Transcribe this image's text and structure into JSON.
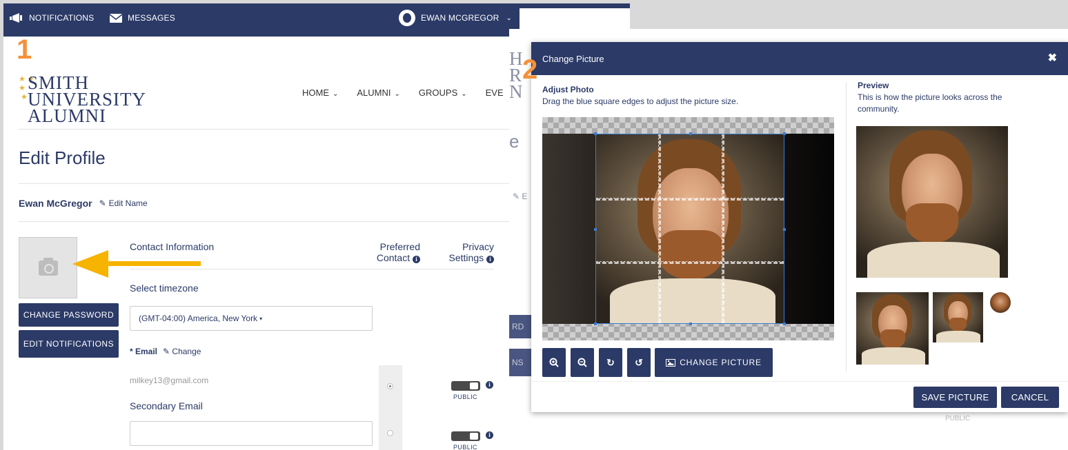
{
  "topbar": {
    "notifications_label": "NOTIFICATIONS",
    "messages_label": "MESSAGES",
    "user_label": "EWAN MCGREGOR"
  },
  "step_numbers": {
    "one": "1",
    "two": "2"
  },
  "logo": {
    "line1": "SMITH",
    "line2": "UNIVERSITY",
    "line3": "ALUMNI"
  },
  "nav": {
    "items": [
      "HOME",
      "ALUMNI",
      "GROUPS",
      "EVE"
    ]
  },
  "page": {
    "title": "Edit Profile",
    "user_name": "Ewan McGregor",
    "edit_name": "Edit Name"
  },
  "buttons": {
    "change_password": "CHANGE PASSWORD",
    "edit_notifications": "EDIT NOTIFICATIONS"
  },
  "contact": {
    "heading": "Contact Information",
    "preferred_contact_line1": "Preferred",
    "preferred_contact_line2": "Contact",
    "privacy_line1": "Privacy",
    "privacy_line2": "Settings",
    "timezone_label": "Select timezone",
    "timezone_value": "(GMT-04:00) America, New York",
    "email_label": "* Email",
    "email_change": "Change",
    "email_value": "milkey13@gmail.com",
    "secondary_email_label": "Secondary Email",
    "public_label": "PUBLIC"
  },
  "ghost": {
    "btn1": "RD",
    "btn2": "NS",
    "edit": "E"
  },
  "modal": {
    "title": "Change Picture",
    "close_glyph": "✖",
    "adjust_heading": "Adjust Photo",
    "adjust_text": "Drag the blue square edges to adjust the picture size.",
    "preview_heading": "Preview",
    "preview_text": "This is how the picture looks across the community.",
    "change_picture_label": "CHANGE PICTURE",
    "save_label": "SAVE PICTURE",
    "cancel_label": "CANCEL",
    "behind_public": "PUBLIC"
  },
  "colors": {
    "brand": "#2b3a67",
    "accent_orange": "#f4913a",
    "arrow": "#f6b400",
    "crop_border": "#3a7bd5"
  },
  "icons": [
    "megaphone-icon",
    "envelope-icon",
    "avatar-icon",
    "chevron-down-icon",
    "camera-icon",
    "pencil-square-icon",
    "info-icon",
    "zoom-in-icon",
    "zoom-out-icon",
    "rotate-right-icon",
    "rotate-left-icon",
    "image-icon",
    "close-icon"
  ]
}
